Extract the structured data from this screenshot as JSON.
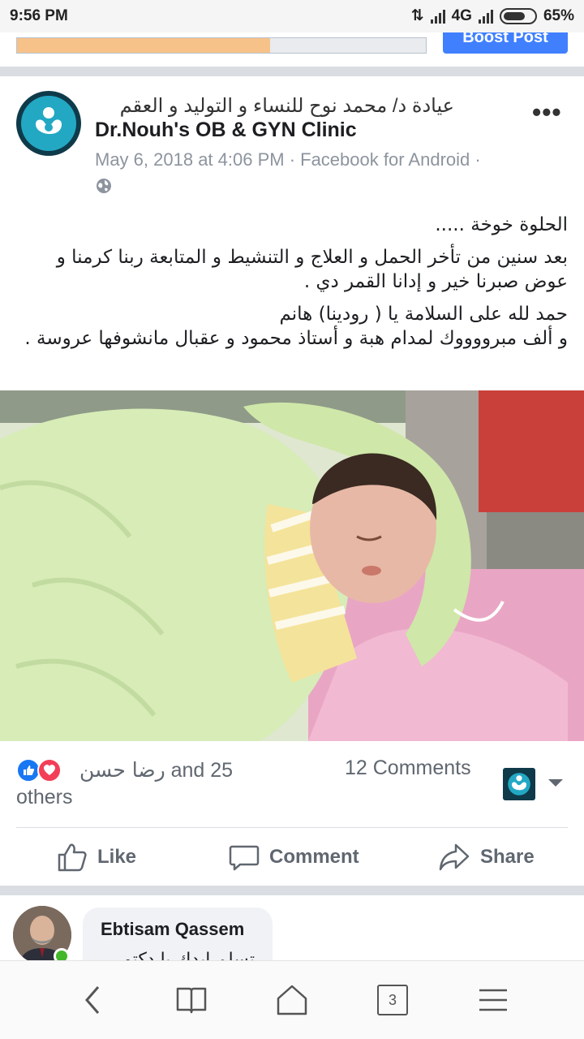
{
  "status_bar": {
    "time": "9:56 PM",
    "network": "4G",
    "battery": "65%"
  },
  "top_strip": {
    "progress_fraction": 0.62,
    "boost_label": "Boost Post"
  },
  "post": {
    "page_name_ar": "عيادة د/ محمد نوح للنساء و التوليد و العقم",
    "page_name_en": "Dr.Nouh's OB & GYN Clinic",
    "meta": "May 6, 2018 at 4:06 PM · Facebook for Android ·",
    "more_label": "•••",
    "text": {
      "line1": "الحلوة خوخة .....",
      "line2": "بعد سنين من تأخر الحمل و العلاج و التنشيط و المتابعة ربنا كرمنا و عوض صبرنا خير و إدانا القمر دي .",
      "line3": "حمد لله على السلامة يا ( رودينا) هانم",
      "line4": "و ألف مبرووووك لمدام هبة و أستاذ محمود و عقبال مانشوفها عروسة ."
    }
  },
  "reactions": {
    "names": "رضا حسن",
    "and_count": "and 25",
    "others": "others",
    "comments": "12 Comments"
  },
  "actions": {
    "like": "Like",
    "comment": "Comment",
    "share": "Share"
  },
  "comment": {
    "author": "Ebtisam Qassem",
    "text": "تسلم ايدك يا دكتور"
  },
  "bottom_nav": {
    "tab_count": "3"
  },
  "colors": {
    "facebook_blue": "#1877f2",
    "love_red": "#f33e58",
    "boost_blue": "#4080ff",
    "clinic_teal": "#23a8c4"
  }
}
